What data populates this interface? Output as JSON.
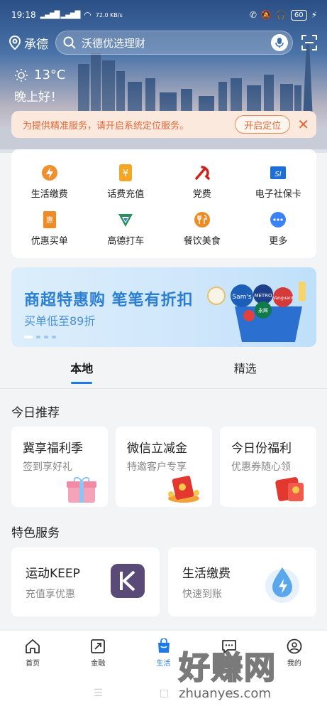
{
  "status": {
    "time": "19:18",
    "signal": "4G 4G",
    "wifi_speed": "72.0 KB/s",
    "battery": "60"
  },
  "header": {
    "location": "承德",
    "search_placeholder": "沃德优选理财"
  },
  "weather": {
    "temp": "13°C",
    "greeting": "晚上好！"
  },
  "notice": {
    "text": "为提供精准服务，请开启系统定位服务。",
    "button": "开启定位",
    "close": "✕"
  },
  "services": [
    {
      "label": "生活缴费",
      "icon": "lightning-icon",
      "color": "#f0902c"
    },
    {
      "label": "话费充值",
      "icon": "yuan-icon",
      "color": "#f5a623"
    },
    {
      "label": "党费",
      "icon": "party-emblem-icon",
      "color": "#d0211b"
    },
    {
      "label": "电子社保卡",
      "icon": "social-security-card-icon",
      "color": "#1e6fd9"
    },
    {
      "label": "优惠买单",
      "icon": "discount-ticket-icon",
      "color": "#f08a24"
    },
    {
      "label": "高德打车",
      "icon": "amap-taxi-icon",
      "color": "#2a8f5e"
    },
    {
      "label": "餐饮美食",
      "icon": "dining-icon",
      "color": "#f08a24"
    },
    {
      "label": "更多",
      "icon": "more-icon",
      "color": "#3b82f6"
    }
  ],
  "banner": {
    "title": "商超特惠购 笔笔有折扣",
    "subtitle": "买单低至89折",
    "stores": [
      "Sam's",
      "METRO",
      "Vanguard",
      "永辉"
    ]
  },
  "tabs": [
    {
      "label": "本地",
      "active": true
    },
    {
      "label": "精选",
      "active": false
    }
  ],
  "today": {
    "title": "今日推荐",
    "cards": [
      {
        "title": "冀享福利季",
        "subtitle": "签到享好礼",
        "icon": "gift-box-icon"
      },
      {
        "title": "微信立减金",
        "subtitle": "特邀客户专享",
        "icon": "red-envelope-icon"
      },
      {
        "title": "今日份福利",
        "subtitle": "优惠券随心领",
        "icon": "coupon-icon"
      }
    ]
  },
  "featured": {
    "title": "特色服务",
    "cards": [
      {
        "title": "运动KEEP",
        "subtitle": "充值享优惠",
        "icon": "keep-logo-icon"
      },
      {
        "title": "生活缴费",
        "subtitle": "快速到账",
        "icon": "water-drop-icon"
      }
    ]
  },
  "nav": [
    {
      "label": "首页",
      "icon": "home-icon",
      "active": false
    },
    {
      "label": "金融",
      "icon": "finance-icon",
      "active": false
    },
    {
      "label": "生活",
      "icon": "shopping-bag-icon",
      "active": true
    },
    {
      "label": "社区",
      "icon": "chat-icon",
      "active": false
    },
    {
      "label": "我的",
      "icon": "profile-icon",
      "active": false
    }
  ],
  "watermark": {
    "brand": "好赚网",
    "url": "zhuanyes.com"
  },
  "colors": {
    "accent": "#1e7be3",
    "notice": "#e0683a"
  }
}
